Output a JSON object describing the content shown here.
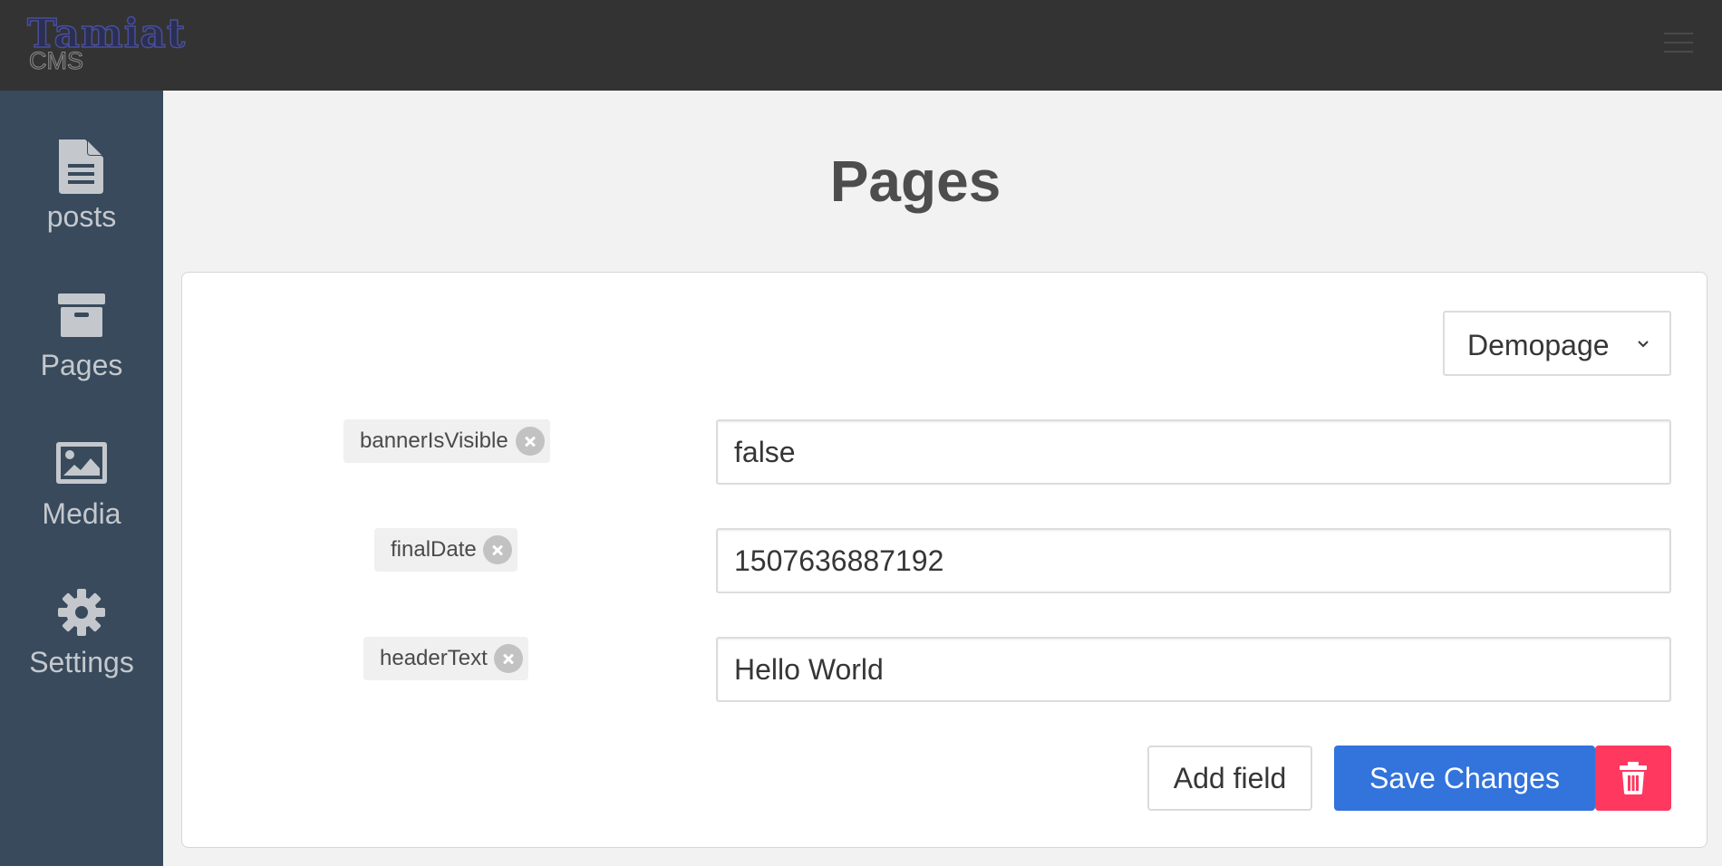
{
  "app": {
    "logo_title": "Tamiat",
    "logo_subtitle": "CMS"
  },
  "sidebar": {
    "items": [
      {
        "label": "posts",
        "icon": "file-text-icon"
      },
      {
        "label": "Pages",
        "icon": "archive-box-icon"
      },
      {
        "label": "Media",
        "icon": "image-icon"
      },
      {
        "label": "Settings",
        "icon": "gear-icon"
      }
    ]
  },
  "main": {
    "title": "Pages",
    "page_select": {
      "selected": "Demopage"
    },
    "fields": [
      {
        "name": "bannerIsVisible",
        "value": "false"
      },
      {
        "name": "finalDate",
        "value": "1507636887192"
      },
      {
        "name": "headerText",
        "value": "Hello World"
      }
    ],
    "buttons": {
      "add_field": "Add field",
      "save": "Save Changes",
      "delete_icon": "trash-icon"
    }
  },
  "colors": {
    "topbar": "#333333",
    "sidebar": "#384a5c",
    "primary": "#3273dc",
    "danger": "#ff3860"
  }
}
